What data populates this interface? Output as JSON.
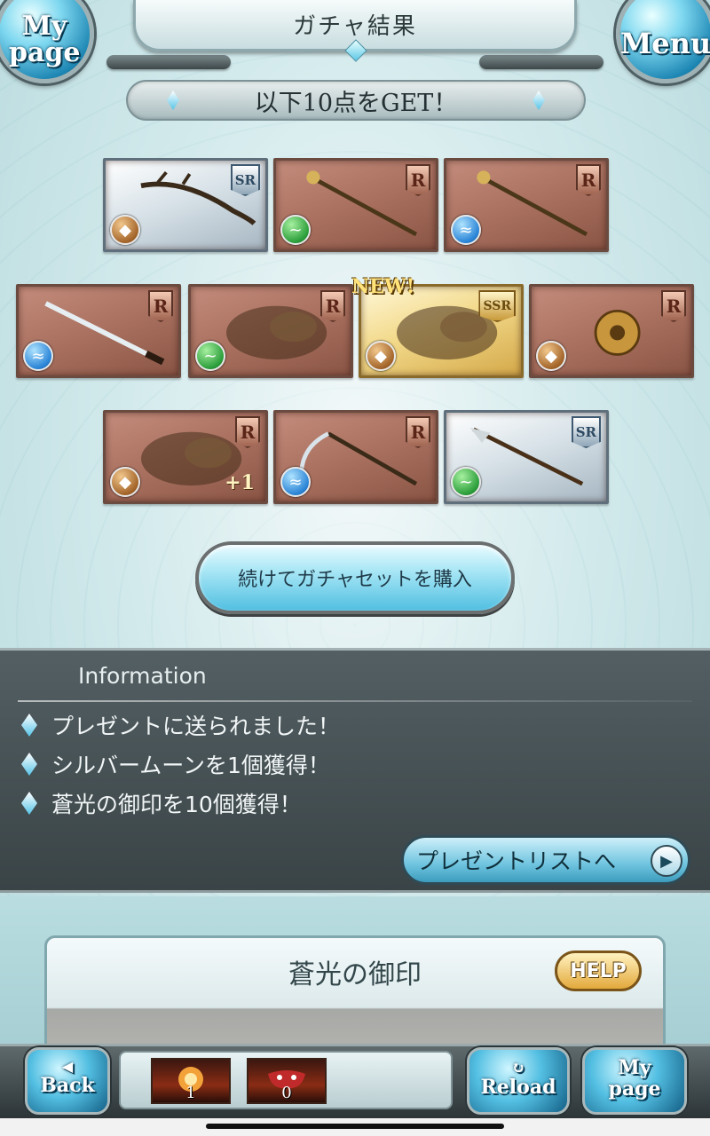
{
  "header": {
    "title": "ガチャ結果",
    "mypage_label": "My page",
    "menu_label": "Menu"
  },
  "banner": {
    "text": "以下10点をGET！"
  },
  "items": [
    {
      "rarity": "SR",
      "element": "earth",
      "weapon": "bow"
    },
    {
      "rarity": "R",
      "element": "wind",
      "weapon": "staff"
    },
    {
      "rarity": "R",
      "element": "water",
      "weapon": "staff"
    },
    {
      "rarity": "R",
      "element": "water",
      "weapon": "katana"
    },
    {
      "rarity": "R",
      "element": "wind",
      "weapon": "summon"
    },
    {
      "rarity": "SSR",
      "element": "earth",
      "weapon": "summon",
      "new": "NEW!"
    },
    {
      "rarity": "R",
      "element": "earth",
      "weapon": "knuckle"
    },
    {
      "rarity": "R",
      "element": "earth",
      "weapon": "summon",
      "plus": "+1"
    },
    {
      "rarity": "R",
      "element": "water",
      "weapon": "scythe"
    },
    {
      "rarity": "SR",
      "element": "wind",
      "weapon": "spear"
    }
  ],
  "continue_button": {
    "label": "続けてガチャセットを購入"
  },
  "information": {
    "title": "Information",
    "lines": [
      "プレゼントに送られました！",
      "シルバームーンを1個獲得！",
      "蒼光の御印を10個獲得！"
    ],
    "present_button": "プレゼントリストへ"
  },
  "lower_card": {
    "title": "蒼光の御印",
    "help_label": "HELP"
  },
  "bottom_bar": {
    "back_label": "Back",
    "reload_label": "Reload",
    "mypage_label": "My page",
    "tray": [
      {
        "count": "1"
      },
      {
        "count": "0"
      }
    ]
  },
  "colors": {
    "accent_blue": "#53bfe2",
    "panel_dark": "#3a4447",
    "bronze_frame": "#a9705f"
  }
}
